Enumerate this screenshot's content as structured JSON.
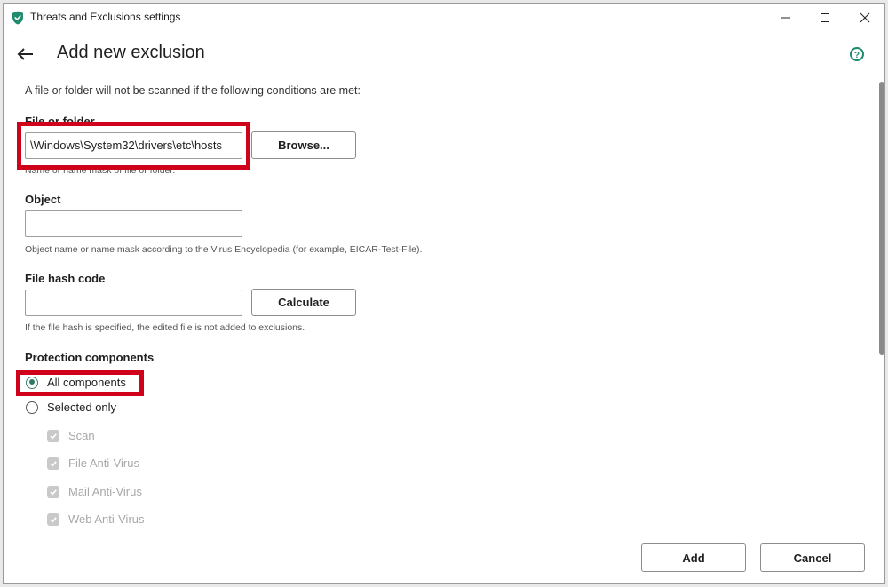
{
  "window": {
    "title": "Threats and Exclusions settings",
    "icon": "shield-check-icon"
  },
  "header": {
    "title": "Add new exclusion",
    "back_icon": "back-arrow-icon",
    "help_icon": "help-icon"
  },
  "intro": "A file or folder will not be scanned if the following conditions are met:",
  "file_or_folder": {
    "label": "File or folder",
    "value": "\\Windows\\System32\\drivers\\etc\\hosts",
    "hint": "Name or name mask of file or folder.",
    "browse_label": "Browse..."
  },
  "object": {
    "label": "Object",
    "value": "",
    "hint": "Object name or name mask according to the Virus Encyclopedia (for example, EICAR-Test-File)."
  },
  "file_hash": {
    "label": "File hash code",
    "value": "",
    "hint": "If the file hash is specified, the edited file is not added to exclusions.",
    "calculate_label": "Calculate"
  },
  "protection": {
    "label": "Protection components",
    "options": [
      {
        "label": "All components",
        "checked": true
      },
      {
        "label": "Selected only",
        "checked": false
      }
    ],
    "components": [
      {
        "label": "Scan",
        "checked": true
      },
      {
        "label": "File Anti-Virus",
        "checked": true
      },
      {
        "label": "Mail Anti-Virus",
        "checked": true
      },
      {
        "label": "Web Anti-Virus",
        "checked": true
      }
    ]
  },
  "footer": {
    "add_label": "Add",
    "cancel_label": "Cancel"
  },
  "colors": {
    "accent": "#2f7a66",
    "highlight": "#d0021b"
  }
}
